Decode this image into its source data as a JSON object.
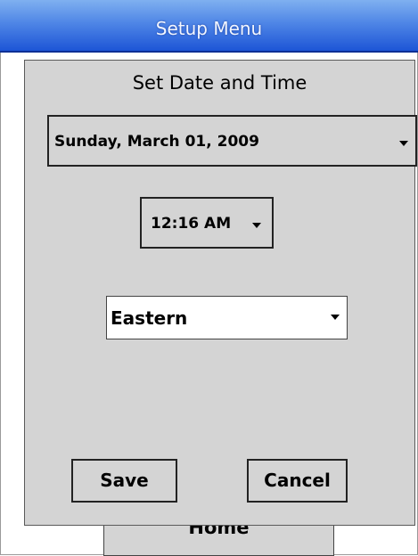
{
  "window": {
    "title": "Setup Menu"
  },
  "background": {
    "home_button_label": "Home"
  },
  "dialog": {
    "title": "Set Date and Time",
    "date_select": {
      "value": "Sunday, March 01, 2009",
      "icon": "chevron-down-icon"
    },
    "time_select": {
      "value": "12:16 AM",
      "icon": "chevron-down-icon"
    },
    "timezone_select": {
      "value": "Eastern",
      "icon": "chevron-down-icon"
    },
    "save_label": "Save",
    "cancel_label": "Cancel"
  },
  "colors": {
    "titlebar_top": "#7fb0f0",
    "titlebar_bottom": "#1d55d6",
    "dialog_bg": "#d4d4d4"
  }
}
